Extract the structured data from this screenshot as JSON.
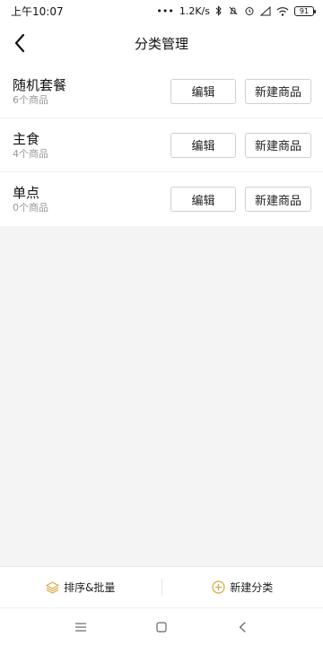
{
  "status_bar": {
    "time": "上午10:07",
    "network_speed": "1.2K/s",
    "battery": "91"
  },
  "header": {
    "title": "分类管理"
  },
  "categories": [
    {
      "name": "随机套餐",
      "count": "6个商品",
      "edit_label": "编辑",
      "new_label": "新建商品"
    },
    {
      "name": "主食",
      "count": "4个商品",
      "edit_label": "编辑",
      "new_label": "新建商品"
    },
    {
      "name": "单点",
      "count": "0个商品",
      "edit_label": "编辑",
      "new_label": "新建商品"
    }
  ],
  "bottom_bar": {
    "sort_label": "排序&批量",
    "add_category_label": "新建分类"
  },
  "icons": {
    "back": "chevron-left-icon",
    "sort": "layers-icon",
    "add": "plus-circle-icon"
  },
  "colors": {
    "accent": "#d4a843"
  }
}
